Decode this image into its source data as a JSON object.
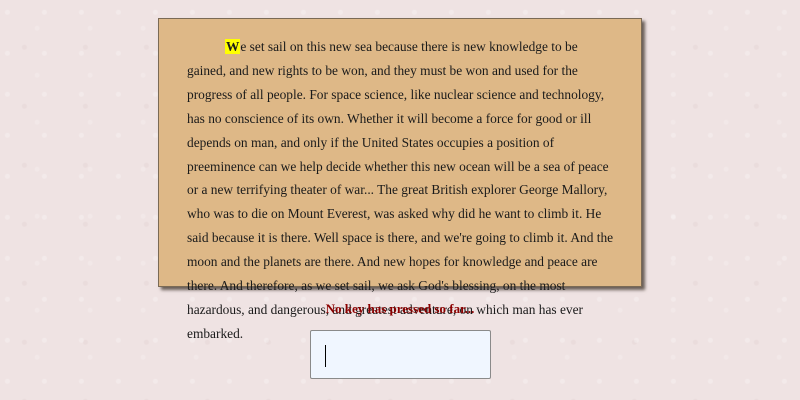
{
  "passage": {
    "first_letter": "W",
    "rest": "e set sail on this new sea because there is new knowledge to be gained, and new rights to be won, and they must be won and used for the progress of all people. For space science, like nuclear science and technology, has no conscience of its own. Whether it will become a force for good or ill depends on man, and only if the United States occupies a position of preeminence can we help decide whether this new ocean will be a sea of peace or a new terrifying theater of war... The great British explorer George Mallory, who was to die on Mount Everest, was asked why did he want to climb it. He said because it is there. Well space is there, and we're going to climb it. And the moon and the planets are there. And new hopes for knowledge and peace are there. And therefore, as we set sail, we ask God's blessing, on the most hazardous, and dangerous, and greatest adventure, on which man has ever embarked."
  },
  "status": {
    "message": "No key has pressed so far..."
  },
  "input": {
    "value": ""
  },
  "colors": {
    "page_background": "#efe3e3",
    "passage_background": "#deb887",
    "highlight": "#ffff00",
    "status_text": "#8b0000",
    "input_background": "#f0f6ff"
  }
}
